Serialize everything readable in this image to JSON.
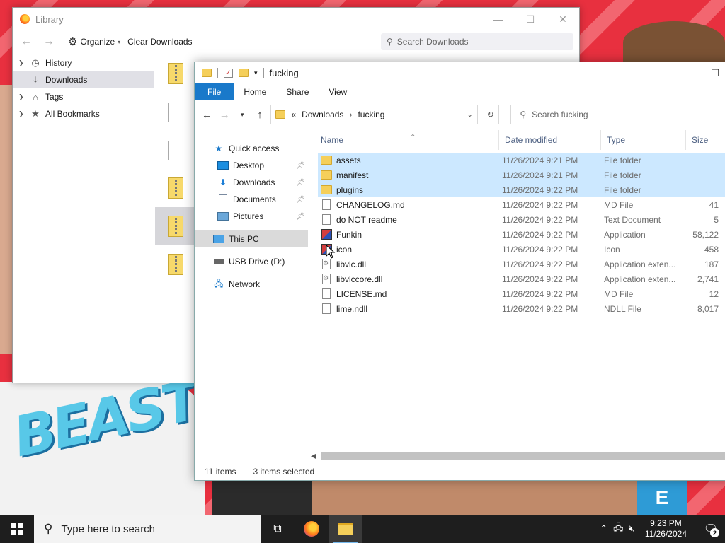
{
  "library": {
    "title": "Library",
    "toolbar": {
      "organize": "Organize",
      "clear_downloads": "Clear Downloads"
    },
    "search_placeholder": "Search Downloads",
    "sidebar": [
      {
        "label": "History",
        "icon": "clock-icon"
      },
      {
        "label": "Downloads",
        "icon": "download-icon",
        "selected": true
      },
      {
        "label": "Tags",
        "icon": "tag-icon"
      },
      {
        "label": "All Bookmarks",
        "icon": "star-icon"
      }
    ]
  },
  "explorer": {
    "title": "fucking",
    "ribbon": {
      "file": "File",
      "home": "Home",
      "share": "Share",
      "view": "View"
    },
    "breadcrumb": {
      "sep": "«",
      "parent": "Downloads",
      "current": "fucking"
    },
    "search_placeholder": "Search fucking",
    "nav": {
      "quick_access": "Quick access",
      "desktop": "Desktop",
      "downloads": "Downloads",
      "documents": "Documents",
      "pictures": "Pictures",
      "this_pc": "This PC",
      "usb": "USB Drive (D:)",
      "network": "Network"
    },
    "columns": {
      "name": "Name",
      "date": "Date modified",
      "type": "Type",
      "size": "Size"
    },
    "files": [
      {
        "name": "assets",
        "date": "11/26/2024 9:21 PM",
        "type": "File folder",
        "size": "",
        "icon": "folder-icon",
        "selected": true
      },
      {
        "name": "manifest",
        "date": "11/26/2024 9:21 PM",
        "type": "File folder",
        "size": "",
        "icon": "folder-icon",
        "selected": true
      },
      {
        "name": "plugins",
        "date": "11/26/2024 9:22 PM",
        "type": "File folder",
        "size": "",
        "icon": "folder-icon",
        "selected": true
      },
      {
        "name": "CHANGELOG.md",
        "date": "11/26/2024 9:22 PM",
        "type": "MD File",
        "size": "41",
        "icon": "document-icon"
      },
      {
        "name": "do NOT readme",
        "date": "11/26/2024 9:22 PM",
        "type": "Text Document",
        "size": "5",
        "icon": "document-icon"
      },
      {
        "name": "Funkin",
        "date": "11/26/2024 9:22 PM",
        "type": "Application",
        "size": "58,122",
        "icon": "app-icon"
      },
      {
        "name": "icon",
        "date": "11/26/2024 9:22 PM",
        "type": "Icon",
        "size": "458",
        "icon": "app-icon"
      },
      {
        "name": "libvlc.dll",
        "date": "11/26/2024 9:22 PM",
        "type": "Application exten...",
        "size": "187",
        "icon": "dll-icon"
      },
      {
        "name": "libvlccore.dll",
        "date": "11/26/2024 9:22 PM",
        "type": "Application exten...",
        "size": "2,741",
        "icon": "dll-icon"
      },
      {
        "name": "LICENSE.md",
        "date": "11/26/2024 9:22 PM",
        "type": "MD File",
        "size": "12",
        "icon": "document-icon"
      },
      {
        "name": "lime.ndll",
        "date": "11/26/2024 9:22 PM",
        "type": "NDLL File",
        "size": "8,017",
        "icon": "document-icon"
      }
    ],
    "status": {
      "items": "11 items",
      "selected": "3 items selected"
    }
  },
  "taskbar": {
    "search_placeholder": "Type here to search",
    "time": "9:23 PM",
    "date": "11/26/2024",
    "notifications": "2"
  },
  "wallpaper": {
    "text": "BEAST"
  }
}
